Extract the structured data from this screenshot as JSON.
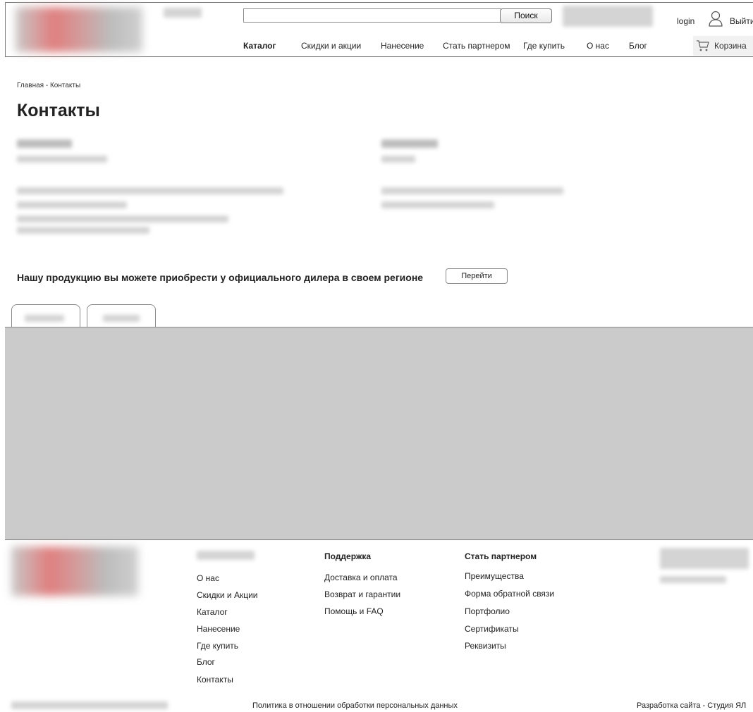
{
  "header": {
    "search": {
      "value": "",
      "placeholder": "",
      "button_label": "Поиск"
    },
    "login_label": "login",
    "logout_label": "Выйти",
    "cart_label": "Корзина",
    "nav": [
      {
        "label": "Каталог",
        "active": true
      },
      {
        "label": "Скидки и акции"
      },
      {
        "label": "Нанесение"
      },
      {
        "label": "Стать партнером"
      },
      {
        "label": "Где купить"
      },
      {
        "label": "О нас"
      },
      {
        "label": "Блог"
      }
    ]
  },
  "breadcrumb": "Главная - Контакты",
  "page_title": "Контакты",
  "dealer": {
    "text": "Нашу продукцию вы можете приобрести у официального дилера в своем регионе",
    "button_label": "Перейти"
  },
  "footer": {
    "support": {
      "heading": "Поддержка",
      "links": [
        "Доставка и оплата",
        "Возврат и гарантии",
        "Помощь и FAQ"
      ]
    },
    "partner": {
      "heading": "Стать партнером",
      "links": [
        "Преимущества",
        "Форма обратной связи",
        "Портфолио",
        "Сертификаты",
        "Реквизиты"
      ]
    },
    "company_links": [
      "О нас",
      "Скидки и Акции",
      "Каталог",
      "Нанесение",
      "Где купить",
      "Блог",
      "Контакты"
    ],
    "privacy_policy": "Политика в отношении обработки персональных данных",
    "developer": "Разработка сайта - Студия ЯЛ"
  },
  "icons": {
    "user": "user-icon",
    "cart": "cart-icon"
  }
}
